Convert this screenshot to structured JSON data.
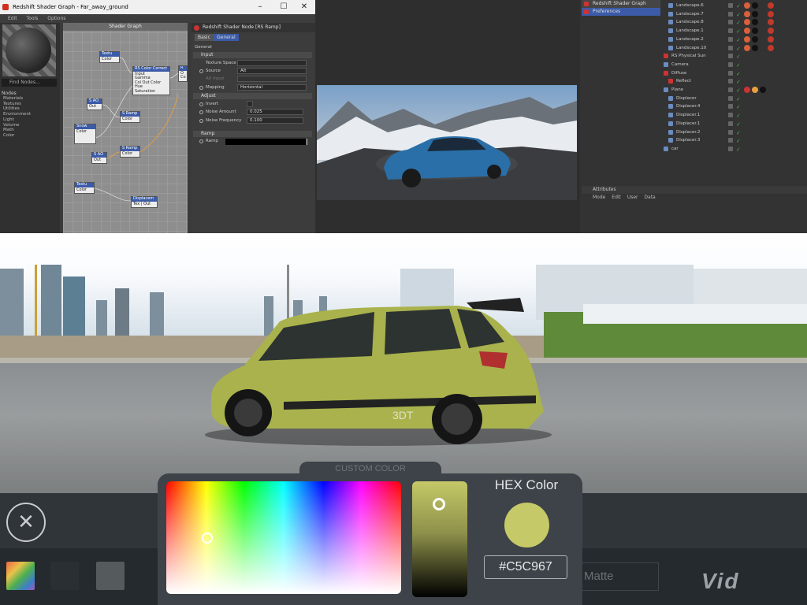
{
  "shader_window": {
    "title": "Redshift Shader Graph - Far_away_ground",
    "menu": [
      "Edit",
      "Tools",
      "Options"
    ],
    "find_nodes_placeholder": "Find Nodes...",
    "nodes_header": "Nodes",
    "node_categories": [
      "Materials",
      "Textures",
      "Utilities",
      "Environment",
      "Light",
      "Volume",
      "Math",
      "Color"
    ],
    "graph_title": "Shader Graph",
    "nodes": [
      {
        "title": "Textu",
        "sub": "Color"
      },
      {
        "title": "RS Color Correct",
        "sub": "Input\nGamma\nCol Out Color\nHue\nSaturation"
      },
      {
        "title": "S AO",
        "sub": "Out"
      },
      {
        "title": "S Ramp",
        "sub": "Color"
      },
      {
        "title": "Snow",
        "sub": "Color"
      },
      {
        "title": "S AO",
        "sub": "Out"
      },
      {
        "title": "S Ramp",
        "sub": "Color"
      },
      {
        "title": "Textu",
        "sub": "Color"
      },
      {
        "title": "Displacem",
        "sub": "Tex | Out"
      },
      {
        "title": "R",
        "sub": "O\nCo"
      }
    ]
  },
  "props_panel": {
    "title": "Redshift Shader Node [RS Ramp]",
    "tabs": [
      "Basic",
      "General"
    ],
    "general": "General",
    "input": "Input",
    "texture_space": "Texture Space",
    "source_label": "Source",
    "source_value": "Alt",
    "alt_input": "Alt Input",
    "mapping_label": "Mapping",
    "mapping_value": "Horizontal",
    "adjust": "Adjust",
    "invert": "Invert",
    "noise_amount_label": "Noise Amount",
    "noise_amount_value": "0.025",
    "noise_freq_label": "Noise Frequency",
    "noise_freq_value": "0.100",
    "ramp_section": "Ramp",
    "ramp_label": "Ramp"
  },
  "object_manager": {
    "popup": [
      "Redshift Shader Graph Editor",
      "Preferences"
    ],
    "objects": [
      "Landscape.6",
      "Landscape.7",
      "Landscape.8",
      "Landscape.1",
      "Landscape.2",
      "Landscape.10",
      "RS Physical Sun",
      "Camera",
      "Diffuse",
      "Reflect",
      "Plane",
      "Displacer",
      "Displacer.4",
      "Displacer.1",
      "Displacer.1",
      "Displacer.2",
      "Displacer.3",
      "car"
    ],
    "attributes": "Attributes",
    "attr_menu": [
      "Mode",
      "Edit",
      "User Data"
    ]
  },
  "game_ui": {
    "custom_color_label": "CUSTOM COLOR",
    "hex_title": "HEX Color",
    "hex_value": "#C5C967",
    "selected_color": "#c5c967",
    "hue_fraction": 0.17,
    "brightness_fraction": 0.14,
    "matte_label": "Matte",
    "brand_partial": "Vid",
    "car_badge": "3DT",
    "swatches": [
      "rainbow",
      "#2a2f33",
      "#555a5d"
    ]
  }
}
